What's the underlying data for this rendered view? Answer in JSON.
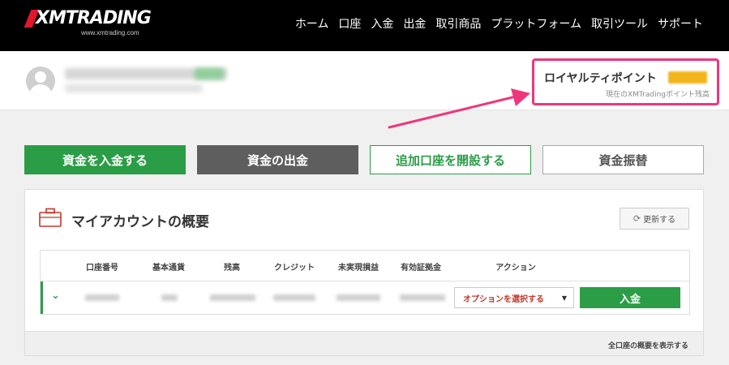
{
  "header": {
    "logo_text": "XMTRADING",
    "logo_url": "www.xmtrading.com",
    "nav": [
      "ホーム",
      "口座",
      "入金",
      "出金",
      "取引商品",
      "プラットフォーム",
      "取引ツール",
      "サポート"
    ]
  },
  "loyalty": {
    "title": "ロイヤルティポイント",
    "subtitle": "現在のXMTradingポイント残高"
  },
  "actions": {
    "deposit": "資金を入金する",
    "withdraw": "資金の出金",
    "open_account": "追加口座を開設する",
    "transfer": "資金振替"
  },
  "panel": {
    "title": "マイアカウントの概要",
    "refresh": "更新する",
    "columns": [
      "口座番号",
      "基本通貨",
      "残高",
      "クレジット",
      "未実現損益",
      "有効証拠金",
      "アクション"
    ],
    "select_placeholder": "オプションを選択する",
    "row_deposit": "入金",
    "footer_link": "全口座の概要を表示する"
  },
  "colors": {
    "accent_green": "#2b9d47",
    "highlight_pink": "#f0357d",
    "points_gold": "#f2b51c"
  }
}
